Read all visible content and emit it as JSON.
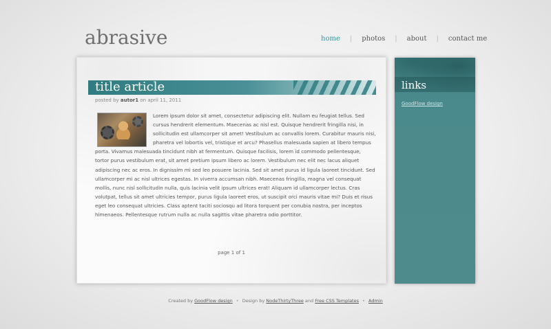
{
  "header": {
    "site_title": "abrasive",
    "nav": [
      {
        "label": "home"
      },
      {
        "label": "photos"
      },
      {
        "label": "about"
      },
      {
        "label": "contact me"
      }
    ]
  },
  "article": {
    "title": "title article",
    "meta_prefix": "posted by",
    "author": "autor1",
    "date_prefix": "on",
    "date": "april 11, 2011",
    "body": "Lorem ipsum dolor sit amet, consectetur adipiscing elit. Nullam eu feugiat tellus. Sed cursus hendrerit elementum. Maecenas ac nisl est. Quisque hendrerit fringilla nisi, in sollicitudin est ullamcorper sit amet! Vestibulum ac convallis lorem. Curabitur mauris nisi, pharetra vel lobortis vel, tristique et arcu? Phasellus malesuada sapien at libero tempus porta. Vivamus malesuada tincidunt nibh at fermentum. Quisque facilisis, lorem id commodo pellentesque, tortor purus vestibulum erat, sit amet pretium ipsum libero ac lorem. Vestibulum nec elit nec lacus aliquet adipiscing nec ac eros. In dignissim mi sed leo posuere lacinia. Sed sit amet purus id ligula laoreet tincidunt. Sed ullamcorper mi ac nisl ultrices egestas. In viverra accumsan nibh. Maecenas fringilla, magna vel consequat mollis, nunc nisl sollicitudin nulla, quis lacinia velit ipsum ultrices erat! Aliquam id ullamcorper lectus. Cras volutpat, tellus sit amet ultricies tempor, purus ligula laoreet eros, ut suscipit orci mauris vitae mi? Duis et risus eget leo consequat ultricies. Class aptent taciti sociosqu ad litora torquent per conubia nostra, per inceptos himenaeos. Pellentesque rutrum nulla ac nulla sagittis vitae pharetra odio porttitor.",
    "pager": "page 1 of 1"
  },
  "sidebar": {
    "title": "links",
    "link": "GoodFlow design"
  },
  "footer": {
    "created_by": "Created by",
    "created_link": "GoodFlow design",
    "design_by": "Design by",
    "design_link": "NodeThirtyThree",
    "and": "and",
    "templates_link": "Free CSS Templates",
    "admin_link": "Admin"
  },
  "colors": {
    "accent": "#2a9aa6",
    "teal": "#4a8a8c"
  }
}
